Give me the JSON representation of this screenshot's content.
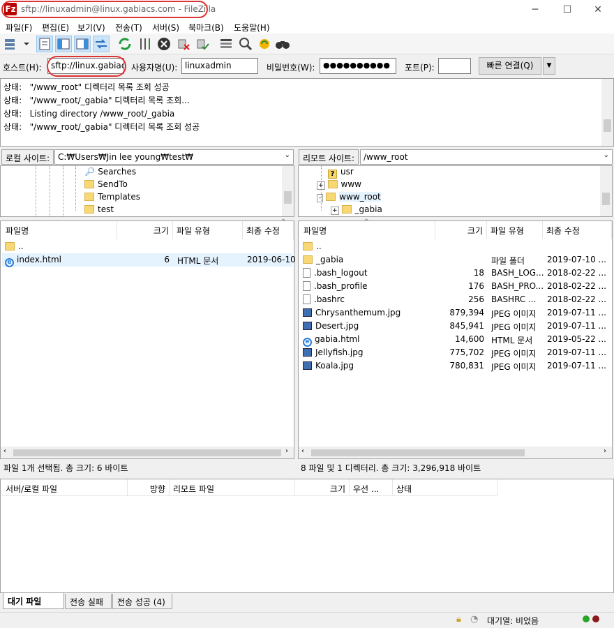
{
  "window": {
    "title": "sftp://linuxadmin@linux.gabiacs.com - FileZilla",
    "app_icon_glyph": "Fz",
    "minimize_glyph": "─",
    "maximize_glyph": "☐",
    "close_glyph": "✕"
  },
  "menu": [
    "파일(F)",
    "편집(E)",
    "보기(V)",
    "전송(T)",
    "서버(S)",
    "북마크(B)",
    "도움말(H)"
  ],
  "toolbar": {
    "icons": [
      "site-manager-icon",
      "toggle-message-log-icon",
      "toggle-local-tree-icon",
      "toggle-remote-tree-icon",
      "toggle-transfer-queue-icon",
      "refresh-icon",
      "process-queue-icon",
      "cancel-icon",
      "disconnect-icon",
      "reconnect-icon",
      "filter-icon",
      "search-icon",
      "sync-browse-icon",
      "find-files-icon"
    ]
  },
  "quickconnect": {
    "host_label": "호스트(H):",
    "host_value": "sftp://linux.gabiacs",
    "user_label": "사용자명(U):",
    "user_value": "linuxadmin",
    "password_label": "비밀번호(W):",
    "password_value": "●●●●●●●●●●",
    "port_label": "포트(P):",
    "port_value": "",
    "connect_label": "빠른 연결(Q)",
    "dropdown_glyph": "▼"
  },
  "log": [
    {
      "label": "상태:",
      "text": "\"/www_root\" 디렉터리 목록 조회 성공"
    },
    {
      "label": "상태:",
      "text": "\"/www_root/_gabia\" 디렉터리 목록 조회..."
    },
    {
      "label": "상태:",
      "text": "Listing directory /www_root/_gabia"
    },
    {
      "label": "상태:",
      "text": "\"/www_root/_gabia\" 디렉터리 목록 조회 성공"
    }
  ],
  "local": {
    "site_label": "로컬 사이트:",
    "path": "C:₩Users₩Jin lee young₩test₩",
    "tree": [
      "Searches",
      "SendTo",
      "Templates",
      "test"
    ],
    "headers": [
      "파일명",
      "크기",
      "파일 유형",
      "최종 수정"
    ],
    "files": [
      {
        "name": "..",
        "size": "",
        "type": "",
        "modified": "",
        "icon": "folder"
      },
      {
        "name": "index.html",
        "size": "6",
        "type": "HTML 문서",
        "modified": "2019-06-10",
        "icon": "html"
      }
    ],
    "status": "파일 1개 선택됨. 총 크기: 6 바이트"
  },
  "remote": {
    "site_label": "리모트 사이트:",
    "path": "/www_root",
    "tree": [
      "usr",
      "www",
      "www_root",
      "_gabia"
    ],
    "headers": [
      "파일명",
      "크기",
      "파일 유형",
      "최종 수정"
    ],
    "files": [
      {
        "name": "..",
        "size": "",
        "type": "",
        "modified": "",
        "icon": "folder"
      },
      {
        "name": "_gabia",
        "size": "",
        "type": "파일 폴더",
        "modified": "2019-07-10 ...",
        "icon": "folder"
      },
      {
        "name": ".bash_logout",
        "size": "18",
        "type": "BASH_LOG...",
        "modified": "2018-02-22 ...",
        "icon": "file"
      },
      {
        "name": ".bash_profile",
        "size": "176",
        "type": "BASH_PRO...",
        "modified": "2018-02-22 ...",
        "icon": "file"
      },
      {
        "name": ".bashrc",
        "size": "256",
        "type": "BASHRC ...",
        "modified": "2018-02-22 ...",
        "icon": "file"
      },
      {
        "name": "Chrysanthemum.jpg",
        "size": "879,394",
        "type": "JPEG 이미지",
        "modified": "2019-07-11 ...",
        "icon": "image"
      },
      {
        "name": "Desert.jpg",
        "size": "845,941",
        "type": "JPEG 이미지",
        "modified": "2019-07-11 ...",
        "icon": "image"
      },
      {
        "name": "gabia.html",
        "size": "14,600",
        "type": "HTML 문서",
        "modified": "2019-05-22 ...",
        "icon": "html"
      },
      {
        "name": "Jellyfish.jpg",
        "size": "775,702",
        "type": "JPEG 이미지",
        "modified": "2019-07-11 ...",
        "icon": "image"
      },
      {
        "name": "Koala.jpg",
        "size": "780,831",
        "type": "JPEG 이미지",
        "modified": "2019-07-11 ...",
        "icon": "image"
      }
    ],
    "status": "8 파일 및 1 디렉터리. 총 크기: 3,296,918 바이트"
  },
  "queue": {
    "headers": [
      "서버/로컬 파일",
      "방향",
      "리모트 파일",
      "크기",
      "우선 ...",
      "상태"
    ],
    "tabs": [
      "대기 파일",
      "전송 실패",
      "전송 성공 (4)"
    ],
    "queue_status": "대기열: 비었음"
  },
  "colors": {
    "accent_ellipse": "#dd3333",
    "folder": "#f8d775",
    "selected_row": "#e5f3ff"
  }
}
